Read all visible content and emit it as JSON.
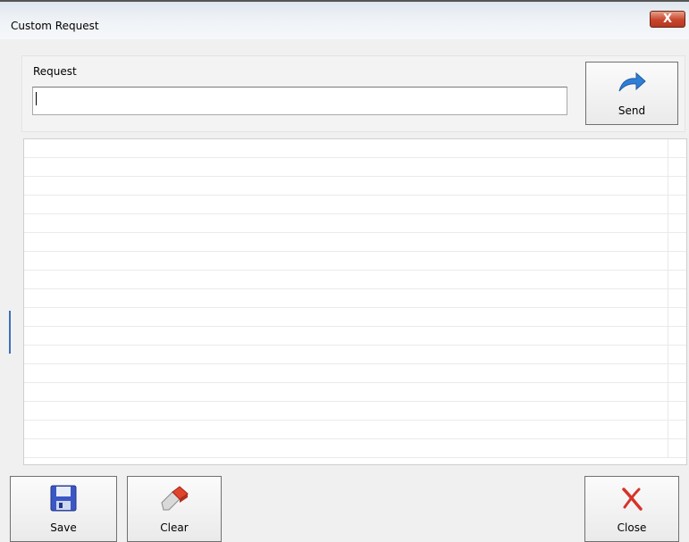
{
  "window": {
    "title": "Custom Request",
    "close_glyph": "X"
  },
  "request": {
    "label": "Request",
    "value": "",
    "placeholder": ""
  },
  "buttons": {
    "send": {
      "label": "Send",
      "icon": "send-arrow-icon"
    },
    "save": {
      "label": "Save",
      "icon": "floppy-disk-icon"
    },
    "clear": {
      "label": "Clear",
      "icon": "eraser-icon"
    },
    "close": {
      "label": "Close",
      "icon": "red-x-icon"
    }
  },
  "results": {
    "rows": [
      "",
      "",
      "",
      "",
      "",
      "",
      "",
      "",
      "",
      "",
      "",
      "",
      "",
      "",
      "",
      "",
      ""
    ]
  },
  "colors": {
    "send_arrow": "#2f7fd6",
    "close_x": "#d6332a",
    "eraser": "#e0442c",
    "floppy": "#3a57c4"
  }
}
